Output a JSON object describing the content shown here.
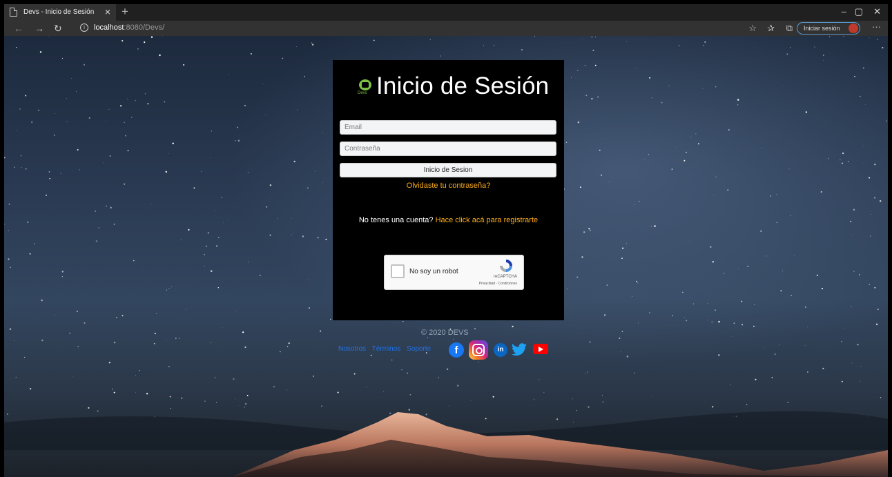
{
  "browser": {
    "tab_title": "Devs - Inicio de Sesión",
    "tab_close": "×",
    "new_tab": "+",
    "url_host": "localhost",
    "url_rest": ":8080/Devs/",
    "sign_in_label": "Iniciar sesión",
    "window_controls": [
      "–",
      "▢",
      "✕"
    ]
  },
  "login": {
    "brand_text": "Devs",
    "title": "Inicio de Sesión",
    "email_placeholder": "Email",
    "password_placeholder": "Contraseña",
    "submit_label": "Inicio de Sesion",
    "forgot_link": "Olvidaste tu contraseña?",
    "register_prompt": "No tenes una cuenta?",
    "register_link": "Hace click acá para registrarte"
  },
  "captcha": {
    "label": "No soy un robot",
    "brand": "reCAPTCHA",
    "legal": "Privacidad - Condiciones"
  },
  "footer": {
    "copyright": "© 2020 DEVS",
    "links": [
      "Nosotros",
      "Términos",
      "Soporte"
    ],
    "social": [
      "facebook-icon",
      "instagram-icon",
      "linkedin-icon",
      "twitter-icon",
      "youtube-icon"
    ],
    "linkedin_glyph": "in",
    "facebook_glyph": "f"
  },
  "colors": {
    "accent_orange": "#ffae1a",
    "link_blue": "#1e73e8",
    "card_bg": "#000000"
  }
}
